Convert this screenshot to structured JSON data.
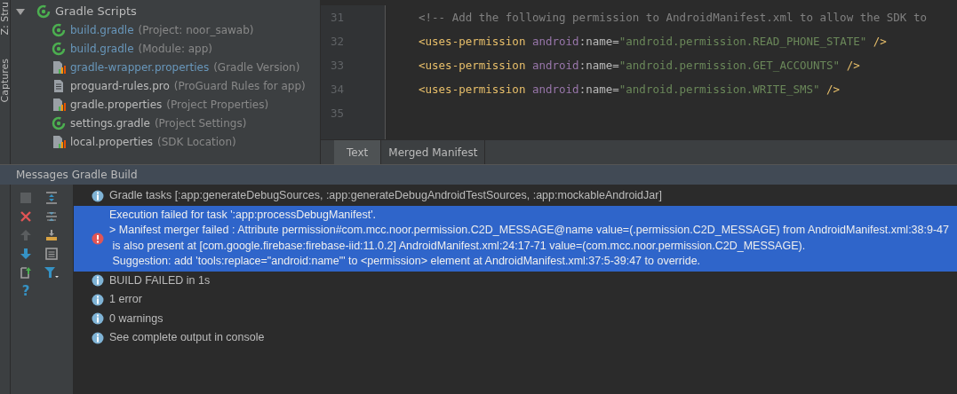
{
  "side_strip": {
    "tabs": [
      "Z: Stru",
      "Captures"
    ]
  },
  "project_tree": {
    "label": "Gradle Scripts",
    "expanded": true,
    "children": [
      {
        "name": "build.gradle",
        "detail": "(Project: noor_sawab)",
        "kind": "gradle",
        "modified": true
      },
      {
        "name": "build.gradle",
        "detail": "(Module: app)",
        "kind": "gradle",
        "modified": true
      },
      {
        "name": "gradle-wrapper.properties",
        "detail": "(Gradle Version)",
        "kind": "properties",
        "modified": true
      },
      {
        "name": "proguard-rules.pro",
        "detail": "(ProGuard Rules for app)",
        "kind": "text",
        "modified": false
      },
      {
        "name": "gradle.properties",
        "detail": "(Project Properties)",
        "kind": "properties",
        "modified": false
      },
      {
        "name": "settings.gradle",
        "detail": "(Project Settings)",
        "kind": "gradle",
        "modified": false
      },
      {
        "name": "local.properties",
        "detail": "(SDK Location)",
        "kind": "properties",
        "modified": false
      }
    ]
  },
  "editor": {
    "lines": [
      {
        "number": "31",
        "tokens": [
          {
            "kind": "comment",
            "text": "<!-- Add the following permission to AndroidManifest.xml to allow the SDK to"
          }
        ]
      },
      {
        "number": "32",
        "tokens": [
          {
            "kind": "tag",
            "text": "<uses-permission "
          },
          {
            "kind": "ns",
            "text": "android"
          },
          {
            "kind": "attr",
            "text": ":name="
          },
          {
            "kind": "string",
            "text": "\"android.permission.READ_PHONE_STATE\""
          },
          {
            "kind": "tag",
            "text": " />"
          }
        ]
      },
      {
        "number": "33",
        "tokens": [
          {
            "kind": "tag",
            "text": "<uses-permission "
          },
          {
            "kind": "ns",
            "text": "android"
          },
          {
            "kind": "attr",
            "text": ":name="
          },
          {
            "kind": "string",
            "text": "\"android.permission.GET_ACCOUNTS\""
          },
          {
            "kind": "tag",
            "text": " />"
          }
        ]
      },
      {
        "number": "34",
        "tokens": [
          {
            "kind": "tag",
            "text": "<uses-permission "
          },
          {
            "kind": "ns",
            "text": "android"
          },
          {
            "kind": "attr",
            "text": ":name="
          },
          {
            "kind": "string",
            "text": "\"android.permission.WRITE_SMS\""
          },
          {
            "kind": "tag",
            "text": " />"
          }
        ]
      },
      {
        "number": "35"
      }
    ],
    "tabs": [
      {
        "label": "Text",
        "selected": true
      },
      {
        "label": "Merged Manifest",
        "selected": false
      }
    ]
  },
  "messages_panel": {
    "title": "Messages Gradle Build",
    "help_button": "?",
    "messages": [
      {
        "kind": "info",
        "selected": false,
        "lines": [
          "Gradle tasks [:app:generateDebugSources, :app:generateDebugAndroidTestSources, :app:mockableAndroidJar]"
        ]
      },
      {
        "kind": "error",
        "selected": true,
        "lines": [
          "Execution failed for task ':app:processDebugManifest'.",
          "> Manifest merger failed : Attribute permission#com.mcc.noor.permission.C2D_MESSAGE@name value=(.permission.C2D_MESSAGE) from AndroidManifest.xml:38:9-47",
          " is also present at [com.google.firebase:firebase-iid:11.0.2] AndroidManifest.xml:24:17-71 value=(com.mcc.noor.permission.C2D_MESSAGE).",
          " Suggestion: add 'tools:replace=\"android:name\"' to <permission> element at AndroidManifest.xml:37:5-39:47 to override."
        ]
      },
      {
        "kind": "info",
        "selected": false,
        "lines": [
          "BUILD FAILED in 1s"
        ]
      },
      {
        "kind": "info",
        "selected": false,
        "lines": [
          "1 error"
        ]
      },
      {
        "kind": "info",
        "selected": false,
        "lines": [
          "0 warnings"
        ]
      },
      {
        "kind": "info",
        "selected": false,
        "lines": [
          "See complete output in console"
        ]
      }
    ]
  }
}
